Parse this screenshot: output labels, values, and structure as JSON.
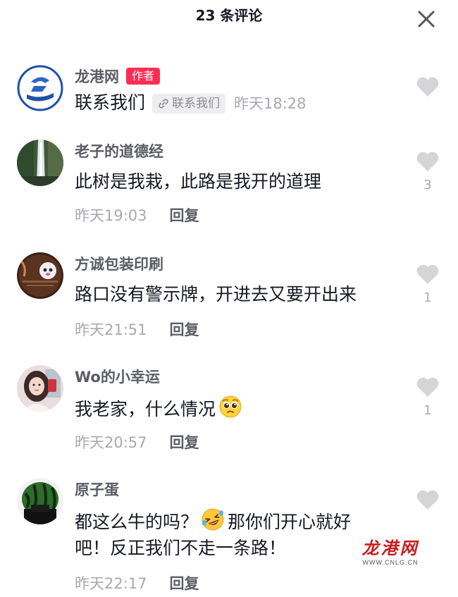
{
  "header": {
    "title": "23 条评论"
  },
  "comments": [
    {
      "author": "龙港网",
      "badge": "作者",
      "text": "联系我们",
      "link_chip": "联系我们",
      "time": "昨天18:28",
      "likes": ""
    },
    {
      "author": "老子的道德经",
      "text": "此树是我栽，此路是我开的道理",
      "time": "昨天19:03",
      "reply": "回复",
      "likes": "3"
    },
    {
      "author": "方诚包装印刷",
      "text": "路口没有警示牌，开进去又要开出来",
      "time": "昨天21:51",
      "reply": "回复",
      "likes": "1"
    },
    {
      "author": "Wo的小幸运",
      "text": "我老家，什么情况",
      "time": "昨天20:57",
      "reply": "回复",
      "likes": "1"
    },
    {
      "author": "原子蛋",
      "text_line1_a": "都这么牛的吗？",
      "text_line1_b": "那你们开心就好",
      "text_line2": "吧！反正我们不走一条路！",
      "time": "昨天22:17",
      "reply": "回复",
      "likes": ""
    }
  ],
  "watermark": {
    "logo": "龙港网",
    "url": "WWW.CNLG.CN"
  },
  "colors": {
    "badge": "#fe2c55",
    "author": "#5b5c64",
    "meta": "#a8a9ae",
    "heart": "#d5d5d8",
    "watermark": "#c81e1e"
  },
  "icons": {
    "close": "close-icon",
    "like": "heart-icon",
    "link": "link-icon",
    "emoji_pleading": "pleading-face-icon",
    "emoji_laughing": "rolling-laughing-face-icon"
  }
}
